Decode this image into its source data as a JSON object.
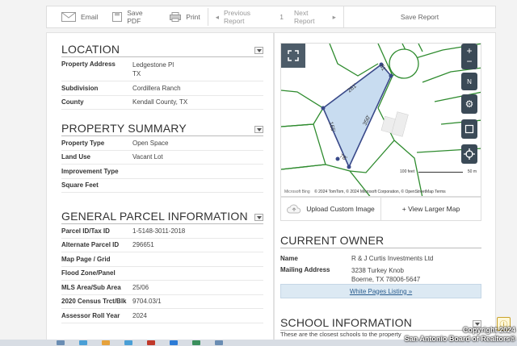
{
  "toolbar": {
    "email": "Email",
    "save_pdf": "Save PDF",
    "print": "Print",
    "prev_report": "Previous Report",
    "report_num": "1",
    "next_report": "Next Report",
    "save_report": "Save Report"
  },
  "location": {
    "title": "LOCATION",
    "rows": [
      {
        "label": "Property Address",
        "value": "Ledgestone Pl",
        "value2": "TX"
      },
      {
        "label": "Subdivision",
        "value": "Cordillera Ranch"
      },
      {
        "label": "County",
        "value": "Kendall County, TX"
      }
    ]
  },
  "summary": {
    "title": "PROPERTY SUMMARY",
    "rows": [
      {
        "label": "Property Type",
        "value": "Open Space"
      },
      {
        "label": "Land Use",
        "value": "Vacant Lot"
      },
      {
        "label": "Improvement Type",
        "value": ""
      },
      {
        "label": "Square Feet",
        "value": ""
      }
    ]
  },
  "parcel": {
    "title": "GENERAL PARCEL INFORMATION",
    "rows": [
      {
        "label": "Parcel ID/Tax ID",
        "value": "1-5148-3011-2018"
      },
      {
        "label": "Alternate Parcel ID",
        "value": "296651"
      },
      {
        "label": "Map Page / Grid",
        "value": ""
      },
      {
        "label": "Flood Zone/Panel",
        "value": ""
      },
      {
        "label": "MLS Area/Sub Area",
        "value": "25/06"
      },
      {
        "label": "2020 Census Trct/Blk",
        "value": "9704.03/1"
      },
      {
        "label": "Assessor Roll Year",
        "value": "2024"
      }
    ]
  },
  "map": {
    "dimensions": [
      "261'",
      "51'",
      "350'",
      "165'",
      "78'"
    ],
    "compass": "N",
    "scale_ft": "100 feet",
    "scale_m": "50 m",
    "copyright": "© 2024 TomTom, © 2024 Microsoft Corporation, © OpenStreetMap  Terms",
    "bing": "Microsoft Bing",
    "upload": "Upload Custom Image",
    "larger": "+ View Larger Map",
    "parcel_color": "#3a4a8a",
    "line_color": "#2e8b2e"
  },
  "owner": {
    "title": "CURRENT OWNER",
    "name_label": "Name",
    "name": "R & J Curtis Investments Ltd",
    "addr_label": "Mailing Address",
    "addr1": "3238 Turkey Knob",
    "addr2": "Boerne, TX 78006-5647",
    "white_pages": "White Pages Listing »"
  },
  "school": {
    "title": "SCHOOL INFORMATION",
    "note": "These are the closest schools to the property"
  },
  "watermark": {
    "line1": "Copyright 2024",
    "line2": "San Antonio Board of Realtors®"
  }
}
